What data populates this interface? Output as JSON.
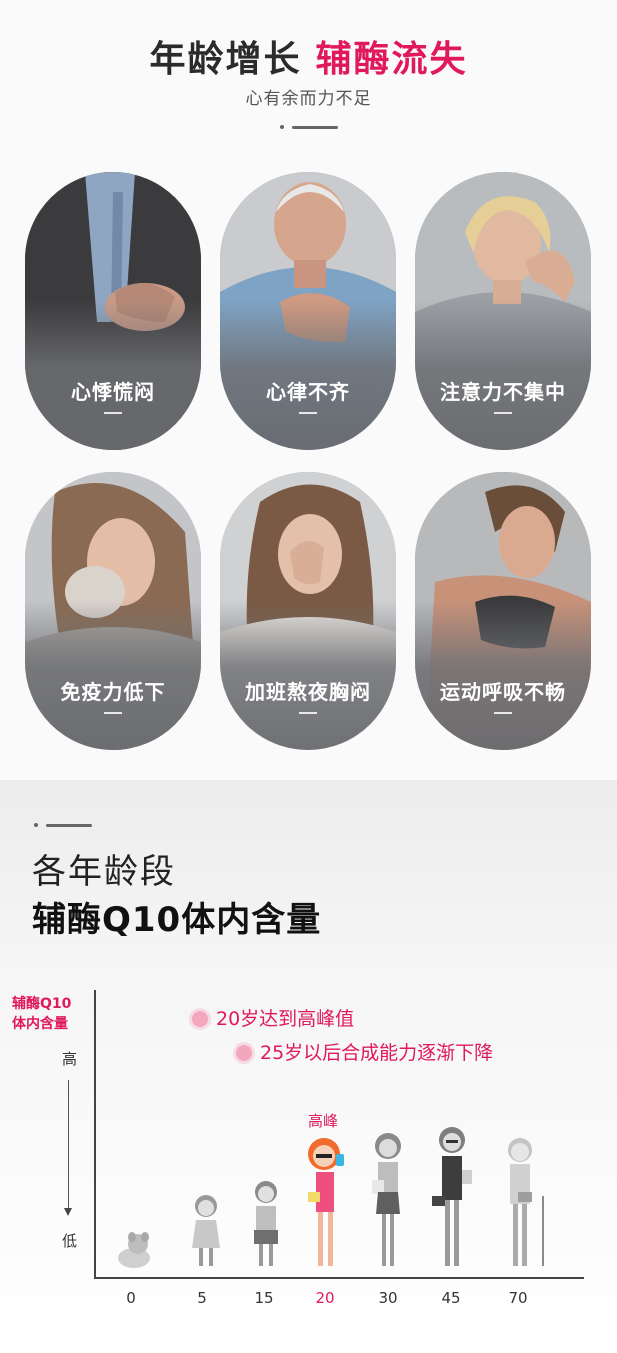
{
  "header": {
    "title_dark": "年龄增长",
    "title_accent": "辅酶流失",
    "subtitle": "心有余而力不足"
  },
  "symptoms": [
    {
      "label": "心悸慌闷",
      "icon": "man-holding-chest"
    },
    {
      "label": "心律不齐",
      "icon": "elderly-man-chest-pain"
    },
    {
      "label": "注意力不集中",
      "icon": "woman-neck-pain"
    },
    {
      "label": "免疫力低下",
      "icon": "woman-sneezing"
    },
    {
      "label": "加班熬夜胸闷",
      "icon": "woman-headache"
    },
    {
      "label": "运动呼吸不畅",
      "icon": "woman-exhausted-exercise"
    }
  ],
  "section2": {
    "heading_line1": "各年龄段",
    "heading_line2": "辅酶Q10体内含量"
  },
  "chart_data": {
    "type": "other",
    "ylabel": "辅酶Q10体内含量",
    "y_high_label": "高",
    "y_low_label": "低",
    "legend": [
      "20岁达到高峰值",
      "25岁以后合成能力逐渐下降"
    ],
    "peak_label": "高峰",
    "peak_age": "20",
    "categories": [
      "0",
      "5",
      "15",
      "20",
      "30",
      "45",
      "70"
    ]
  },
  "colors": {
    "accent": "#e0195a",
    "legend_dot": "#f3a7be",
    "card_gray": "#8d9196"
  }
}
